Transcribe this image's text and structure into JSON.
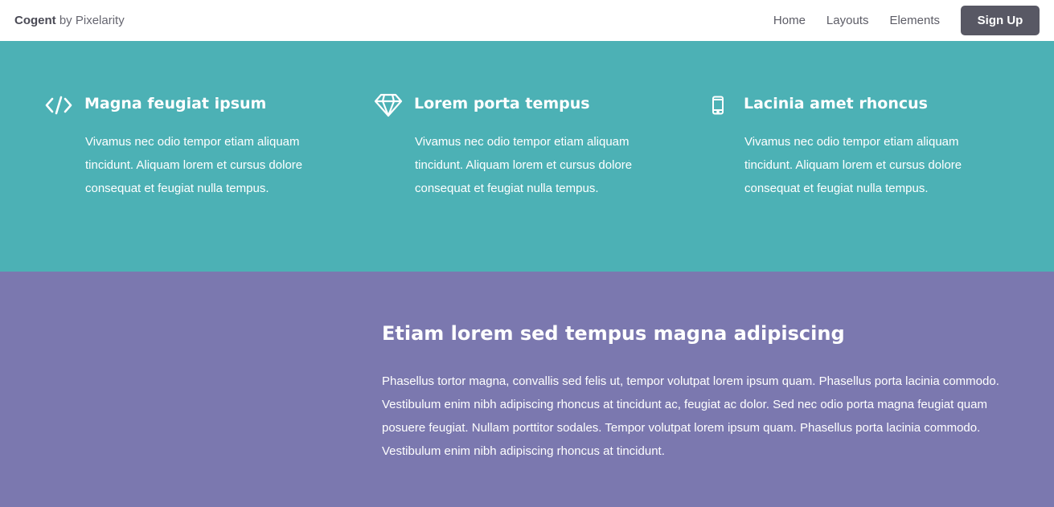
{
  "header": {
    "brand_name": "Cogent",
    "brand_by": "by Pixelarity",
    "nav": [
      {
        "label": "Home"
      },
      {
        "label": "Layouts"
      },
      {
        "label": "Elements"
      }
    ],
    "signup_label": "Sign Up"
  },
  "features": [
    {
      "icon": "code-icon",
      "title": "Magna feugiat ipsum",
      "text": "Vivamus nec odio tempor etiam aliquam tincidunt. Aliquam lorem et cursus dolore consequat et feugiat nulla tempus."
    },
    {
      "icon": "diamond-icon",
      "title": "Lorem porta tempus",
      "text": "Vivamus nec odio tempor etiam aliquam tincidunt. Aliquam lorem et cursus dolore consequat et feugiat nulla tempus."
    },
    {
      "icon": "mobile-icon",
      "title": "Lacinia amet rhoncus",
      "text": "Vivamus nec odio tempor etiam aliquam tincidunt. Aliquam lorem et cursus dolore consequat et feugiat nulla tempus."
    }
  ],
  "section2": {
    "title": "Etiam lorem sed tempus magna adipiscing",
    "text": "Phasellus tortor magna, convallis sed felis ut, tempor volutpat lorem ipsum quam. Phasellus porta lacinia commodo. Vestibulum enim nibh adipiscing rhoncus at tincidunt ac, feugiat ac dolor. Sed nec odio porta magna feugiat quam posuere feugiat. Nullam porttitor sodales. Tempor volutpat lorem ipsum quam. Phasellus porta lacinia commodo. Vestibulum enim nibh adipiscing rhoncus at tincidunt."
  },
  "colors": {
    "teal": "#4cb1b5",
    "purple": "#7b78af",
    "button": "#585864"
  }
}
